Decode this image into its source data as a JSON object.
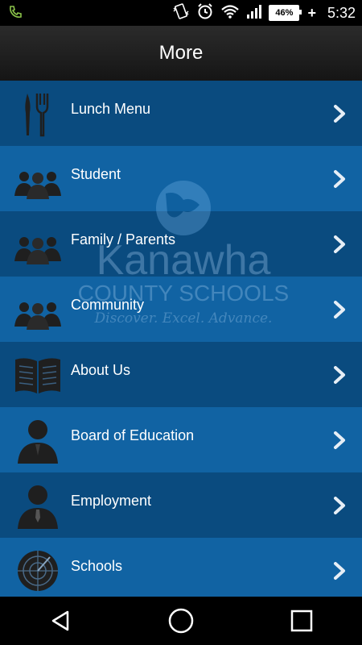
{
  "status_bar": {
    "time": "5:32",
    "battery": "46%",
    "charging": "+",
    "icons": [
      "phone-call-icon",
      "vibrate-icon",
      "alarm-icon",
      "wifi-icon",
      "signal-icon",
      "battery-icon"
    ]
  },
  "header": {
    "title": "More"
  },
  "watermark": {
    "name": "Kanawha",
    "subtitle": "COUNTY SCHOOLS",
    "tagline": "Discover. Excel. Advance."
  },
  "menu": {
    "items": [
      {
        "label": "Lunch Menu",
        "icon": "fork-knife-icon"
      },
      {
        "label": "Student",
        "icon": "group-icon"
      },
      {
        "label": "Family / Parents",
        "icon": "group-icon"
      },
      {
        "label": "Community",
        "icon": "group-icon"
      },
      {
        "label": "About Us",
        "icon": "book-icon"
      },
      {
        "label": "Board of Education",
        "icon": "person-icon"
      },
      {
        "label": "Employment",
        "icon": "person-tie-icon"
      },
      {
        "label": "Schools",
        "icon": "radar-icon"
      }
    ]
  },
  "nav_bar": {
    "buttons": [
      "back-icon",
      "home-icon",
      "recents-icon"
    ]
  },
  "colors": {
    "accent": "#0e5d99",
    "header_bg": "#1e1e1e"
  }
}
